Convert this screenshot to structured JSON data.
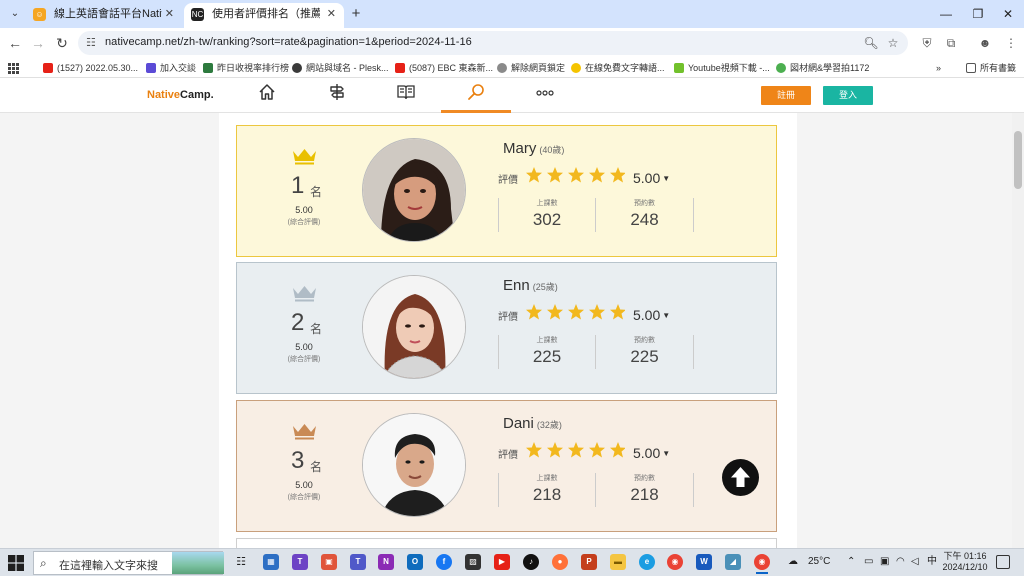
{
  "browser": {
    "tabs": [
      {
        "title": "線上英語會話平台NativeCamp",
        "active": false
      },
      {
        "title": "使用者評價排名（推薦）講師一",
        "active": true
      }
    ],
    "url": "nativecamp.net/zh-tw/ranking?sort=rate&pagination=1&period=2024-11-16",
    "bookmarks": [
      {
        "label": "(1527) 2022.05.30...",
        "color": "#e62117"
      },
      {
        "label": "加入交談",
        "color": "#5b4bd6"
      },
      {
        "label": "昨日收視率排行榜",
        "color": "#2d7a3e"
      },
      {
        "label": "網站與域名 - Plesk...",
        "color": "#3a3a3a"
      },
      {
        "label": "(5087) EBC 東森新...",
        "color": "#e62117"
      },
      {
        "label": "解除網頁鎖定",
        "color": "#8a8a8a"
      },
      {
        "label": "在線免費文字轉語...",
        "color": "#f5c400"
      },
      {
        "label": "Youtube視頻下載 -...",
        "color": "#72c12c"
      },
      {
        "label": "図材網&學習拍1172",
        "color": "#4caf50"
      }
    ],
    "all_bookmarks_label": "所有書籤"
  },
  "site": {
    "logo_native": "Native",
    "logo_camp": "Camp.",
    "signup_label": "註冊",
    "login_label": "登入",
    "nav_icons": [
      "home-icon",
      "signpost-icon",
      "book-icon",
      "search-icon",
      "more-icon"
    ],
    "active_nav": "search-icon"
  },
  "ranking": {
    "rank_unit": "名",
    "score_label": "(綜合評價)",
    "rating_label": "評價",
    "lessons_label": "上課數",
    "bookings_label": "預約數",
    "teachers": [
      {
        "rank": "1",
        "score": "5.00",
        "name": "Mary",
        "age": "(40歲)",
        "rating": "5.00",
        "stars": 5,
        "lessons": "302",
        "bookings": "248",
        "crown_color": "#e9c000"
      },
      {
        "rank": "2",
        "score": "5.00",
        "name": "Enn",
        "age": "(25歲)",
        "rating": "5.00",
        "stars": 5,
        "lessons": "225",
        "bookings": "225",
        "crown_color": "#b0bcc6"
      },
      {
        "rank": "3",
        "score": "5.00",
        "name": "Dani",
        "age": "(32歲)",
        "rating": "5.00",
        "stars": 5,
        "lessons": "218",
        "bookings": "218",
        "crown_color": "#c98a55"
      }
    ]
  },
  "taskbar": {
    "search_placeholder": "在這裡輸入文字來搜",
    "weather": "25°C",
    "ime": "中",
    "time": "下午 01:16",
    "date": "2024/12/10"
  }
}
